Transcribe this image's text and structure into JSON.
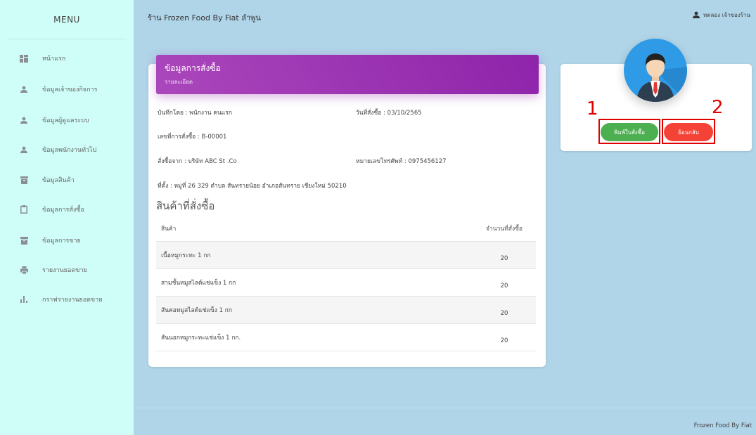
{
  "sidebar": {
    "title": "MENU",
    "items": [
      {
        "label": "หน้าแรก",
        "icon": "dashboard-icon"
      },
      {
        "label": "ข้อมูลเจ้าของกิจการ",
        "icon": "person-icon"
      },
      {
        "label": "ข้อมูลผู้ดูแลระบบ",
        "icon": "person-icon"
      },
      {
        "label": "ข้อมูลพนักงานทั่วไป",
        "icon": "person-icon"
      },
      {
        "label": "ข้อมูลสินค้า",
        "icon": "archive-icon"
      },
      {
        "label": "ข้อมูลการสั่งซื้อ",
        "icon": "clipboard-icon"
      },
      {
        "label": "ข้อมูลการขาย",
        "icon": "archive-icon"
      },
      {
        "label": "รายงานยอดขาย",
        "icon": "print-icon"
      },
      {
        "label": "กราฟรายงานยอดขาย",
        "icon": "bar-chart-icon"
      }
    ]
  },
  "header": {
    "title": "ร้าน Frozen Food By Fiat ลำพูน",
    "user": "ทดลอง เจ้าของร้าน"
  },
  "order": {
    "header_title": "ข้อมูลการสั่งซื้อ",
    "header_subtitle": "รายละเอียด",
    "recorded_by": "บันทึกโดย : พนักงาน คนแรก",
    "order_date": "วันที่สั่งซื้อ : 03/10/2565",
    "order_no": "เลขที่การสั่งซื้อ : B-00001",
    "ordered_from": "สั่งซื้อจาก : บริษัท ABC St .Co",
    "phone": "หมายเลขโทรศัพท์ : 0975456127",
    "address": "ที่ตั้ง : หมู่ที่ 26 329 ตำบล สันทรายน้อย อำเภอสันทราย เชียงใหม่ 50210",
    "section_title": "สินค้าที่สั่งซื้อ",
    "columns": [
      "สินค้า",
      "จำนวนที่สั่งซื้อ"
    ],
    "rows": [
      {
        "product": "เนื้อหมูกระทะ 1 กก",
        "qty": "20"
      },
      {
        "product": "สามชั้นหมูสไลด์แช่แข็ง 1 กก",
        "qty": "20"
      },
      {
        "product": "สันคอหมูสไลด์แช่แข็ง 1 กก",
        "qty": "20"
      },
      {
        "product": "สันนอกหมูกระทะแช่แข็ง 1 กก.",
        "qty": "20"
      }
    ]
  },
  "actions": {
    "print_label": "พิมพ์ใบสั่งซื้อ",
    "back_label": "ย้อนกลับ",
    "marker_1": "1",
    "marker_2": "2"
  },
  "footer": "Frozen Food By Fiat",
  "colors": {
    "sidebar_bg": "#cffdf7",
    "page_bg": "#b0d4e8",
    "purple": "#9c27b0",
    "green": "#4caf50",
    "red": "#f44336",
    "annotation_red": "#e00000"
  }
}
